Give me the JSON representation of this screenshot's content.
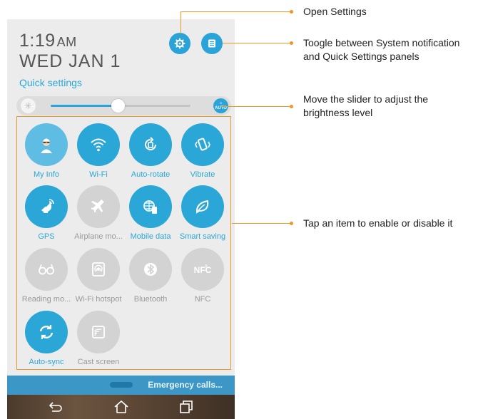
{
  "clock": {
    "time": "1:19",
    "ampm": "AM",
    "date": "WED JAN 1"
  },
  "quick_settings_label": "Quick settings",
  "icons": {
    "settings": "gear-icon",
    "toggle": "notification-list-icon",
    "brightness_low": "brightness-icon",
    "auto_brightness": "auto-brightness-icon"
  },
  "brightness": {
    "level": 0.48,
    "auto_top": "☼",
    "auto_bottom": "AUTO"
  },
  "tiles": [
    {
      "label": "My Info",
      "state": "on"
    },
    {
      "label": "Wi-Fi",
      "state": "on"
    },
    {
      "label": "Auto-rotate",
      "state": "on"
    },
    {
      "label": "Vibrate",
      "state": "on"
    },
    {
      "label": "GPS",
      "state": "on"
    },
    {
      "label": "Airplane mo...",
      "state": "off"
    },
    {
      "label": "Mobile data",
      "state": "on"
    },
    {
      "label": "Smart saving",
      "state": "on"
    },
    {
      "label": "Reading mo...",
      "state": "off"
    },
    {
      "label": "Wi-Fi hotspot",
      "state": "off"
    },
    {
      "label": "Bluetooth",
      "state": "off"
    },
    {
      "label": "NFC",
      "state": "off"
    },
    {
      "label": "Auto-sync",
      "state": "on"
    },
    {
      "label": "Cast screen",
      "state": "off"
    }
  ],
  "emergency_calls": "Emergency calls...",
  "callouts": {
    "open_settings": "Open Settings",
    "toggle_panels_line1": "Toogle between System notification",
    "toggle_panels_line2": "and Quick Settings panels",
    "slider_line1": "Move the slider to adjust the",
    "slider_line2": "brightness level",
    "tap_item": "Tap an item to enable or disable it"
  },
  "colors": {
    "accent": "#2aa7d6",
    "callout": "#f19524",
    "tile_off": "#d3d3d3"
  }
}
